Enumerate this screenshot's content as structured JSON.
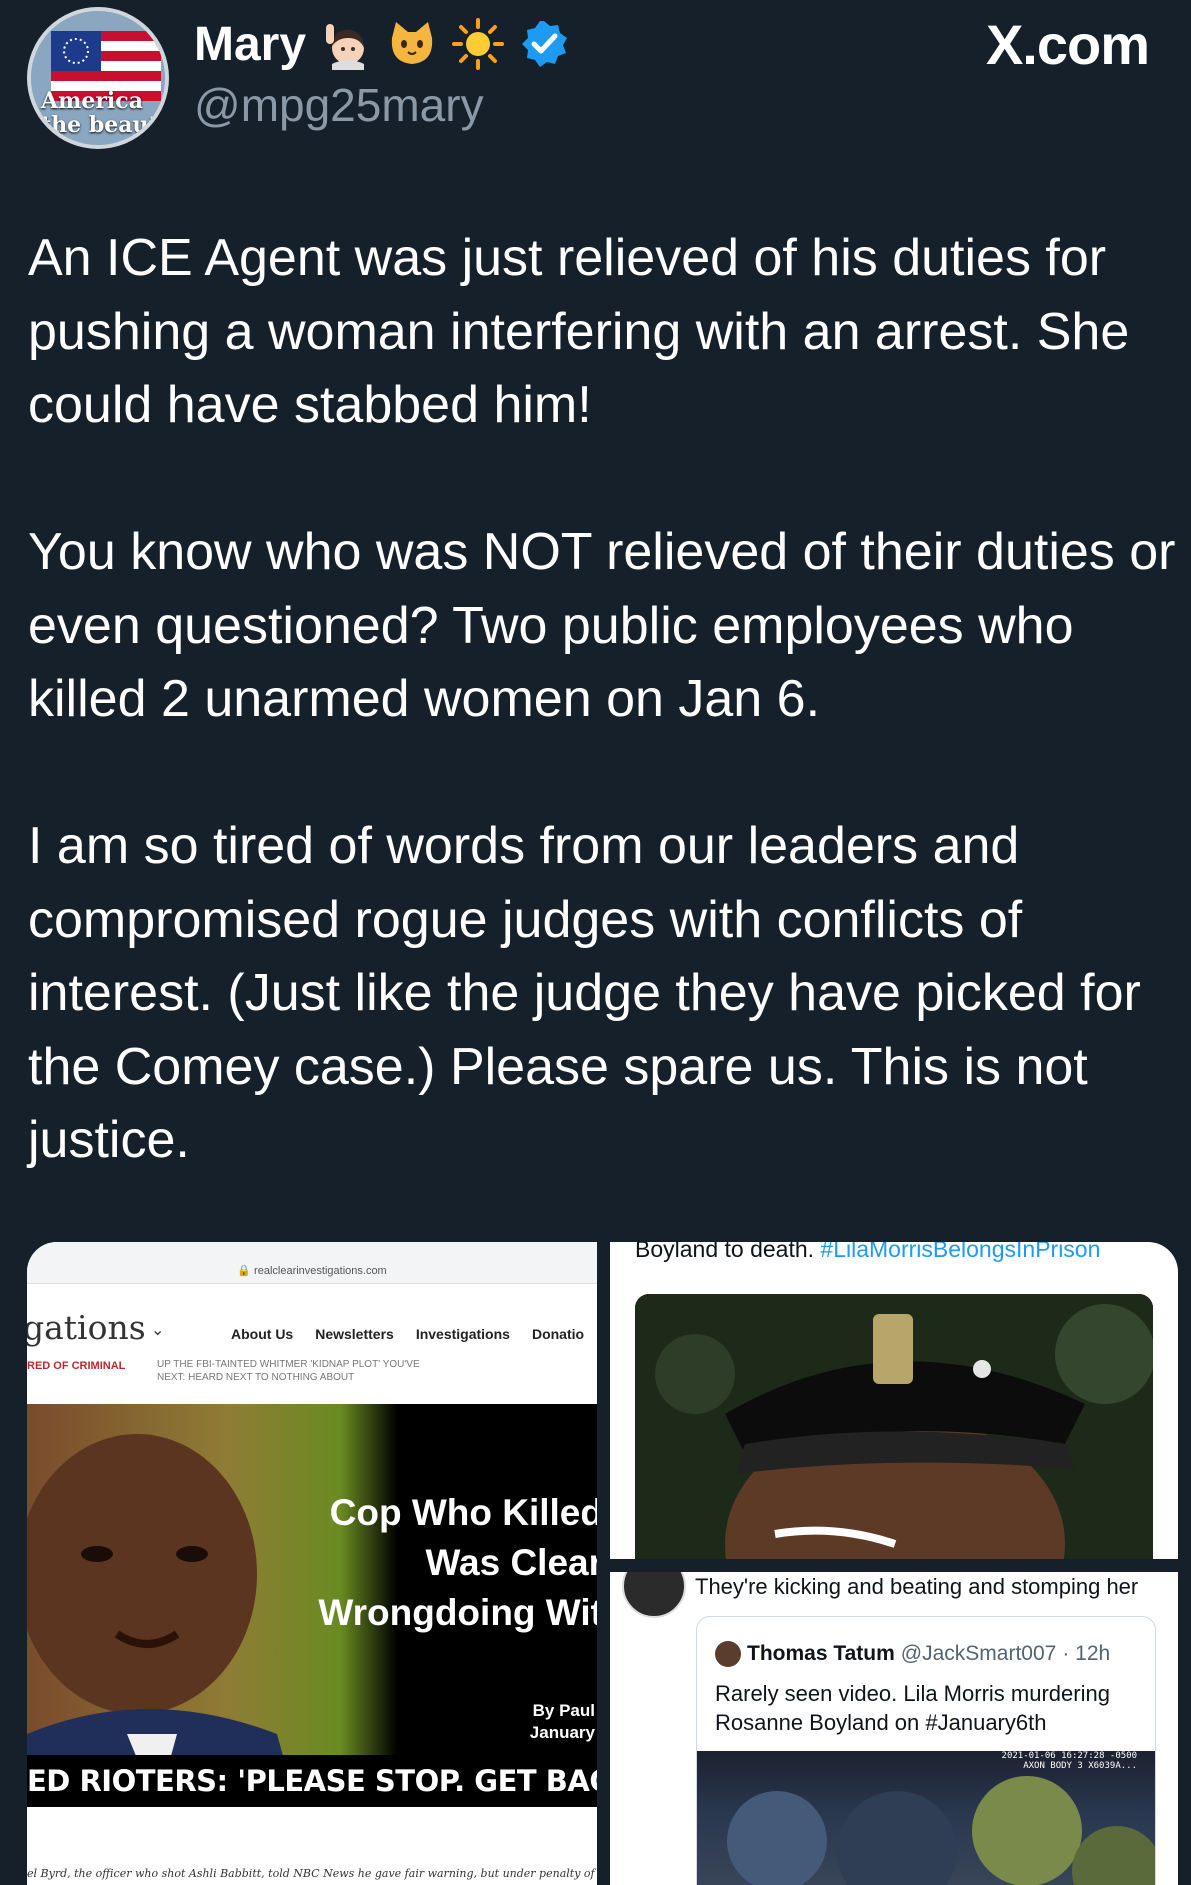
{
  "header": {
    "display_name": "Mary",
    "handle": "@mpg25mary",
    "brand": "X.com",
    "avatar_text": [
      "America",
      "the beautiful"
    ],
    "icons": [
      "woman-raising-hand-emoji",
      "cat-face-emoji",
      "sun-emoji",
      "verified-badge-icon"
    ],
    "accent": "#1d9bf0"
  },
  "tweet": {
    "paragraphs": [
      "An ICE Agent was just relieved of his duties for pushing a woman interfering with an arrest. She could have stabbed him!",
      "You know who was NOT relieved of their duties or even questioned? Two public employees who killed 2 unarmed women on Jan 6.",
      "I am so tired of words from our leaders and compromised rogue judges with conflicts of interest. (Just like the judge they have picked for the Comey case.) Please spare us. This is not justice."
    ]
  },
  "media_left": {
    "url": "realclearinvestigations.com",
    "site_logo": "gations",
    "nav": [
      "About Us",
      "Newsletters",
      "Investigations",
      "Donatio"
    ],
    "red_tag": "RED OF CRIMINAL",
    "ticker_1": "UP     THE FBI-TAINTED WHITMER 'KIDNAP PLOT' YOU'VE",
    "ticker_2": "NEXT:  HEARD NEXT TO NOTHING ABOUT",
    "video_title_1": "Cop Who Killed",
    "video_title_2": "Was Clear",
    "video_title_3": "Wrongdoing Wit",
    "byline_1": "By Paul",
    "byline_2": "January",
    "banner": "ED RIOTERS: 'PLEASE STOP. GET BACK.'",
    "caption": "el Byrd, the officer who shot Ashli Babbitt, told NBC News he gave fair warning, but under penalty of perjury he"
  },
  "media_right_top": {
    "text": "Boyland to death.",
    "hashtag": "#LilaMorrisBelongsInPrison"
  },
  "media_right_bottom": {
    "text": "They're kicking and beating and stomping her",
    "quote_name": "Thomas Tatum",
    "quote_handle": "@JackSmart007",
    "quote_time": "· 12h",
    "quote_body_1": "Rarely seen video. Lila Morris murdering",
    "quote_body_2": "Rosanne Boyland on #January6th",
    "stamp_1": "2021-01-06 16:27:28 -0500",
    "stamp_2": "AXON BODY 3 X6039A..."
  }
}
